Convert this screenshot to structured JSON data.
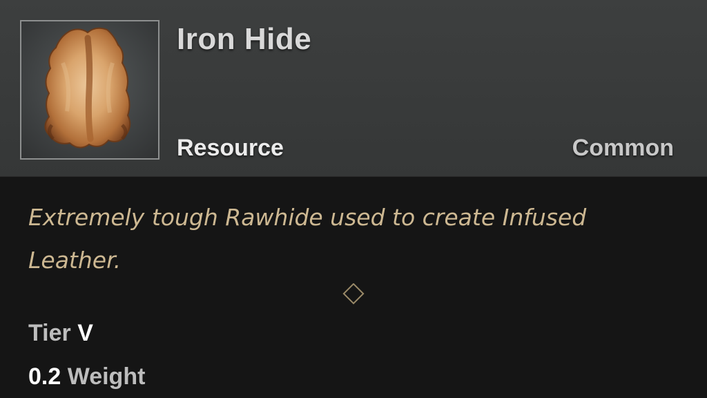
{
  "item": {
    "name": "Iron Hide",
    "type": "Resource",
    "rarity": "Common",
    "icon": "animal-hide-icon",
    "description": "Extremely tough Rawhide used to create Infused Leather."
  },
  "stats": {
    "tier_label": "Tier",
    "tier_value": "V",
    "weight_value": "0.2",
    "weight_label": "Weight"
  },
  "colors": {
    "header_bg": "#3a3c3c",
    "body_bg": "#151515",
    "description_text": "#cdb892",
    "divider": "#6b6148"
  }
}
